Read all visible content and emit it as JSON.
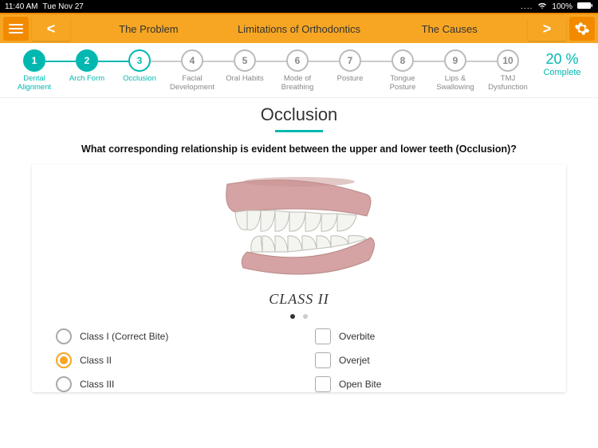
{
  "status": {
    "time": "11:40 AM",
    "date": "Tue Nov 27",
    "wifi": "100%"
  },
  "nav": {
    "prev": "<",
    "next": ">",
    "tabs": [
      "The Problem",
      "Limitations of Orthodontics",
      "The Causes"
    ]
  },
  "stepper": {
    "steps": [
      {
        "n": "1",
        "label": "Dental Alignment",
        "state": "done"
      },
      {
        "n": "2",
        "label": "Arch Form",
        "state": "done"
      },
      {
        "n": "3",
        "label": "Occlusion",
        "state": "active"
      },
      {
        "n": "4",
        "label": "Facial Development",
        "state": ""
      },
      {
        "n": "5",
        "label": "Oral Habits",
        "state": ""
      },
      {
        "n": "6",
        "label": "Mode of Breathing",
        "state": ""
      },
      {
        "n": "7",
        "label": "Posture",
        "state": ""
      },
      {
        "n": "8",
        "label": "Tongue Posture",
        "state": ""
      },
      {
        "n": "9",
        "label": "Lips & Swallowing",
        "state": ""
      },
      {
        "n": "10",
        "label": "TMJ Dysfunction",
        "state": ""
      }
    ],
    "completion_pct": "20 %",
    "completion_label": "Complete"
  },
  "section": {
    "title": "Occlusion",
    "question": "What corresponding relationship is evident between the upper and lower teeth (Occlusion)?",
    "illustration_caption": "CLASS II",
    "page_dots": {
      "count": 2,
      "active": 0
    },
    "radios": [
      {
        "label": "Class I (Correct Bite)",
        "selected": false
      },
      {
        "label": "Class II",
        "selected": true
      },
      {
        "label": "Class III",
        "selected": false
      }
    ],
    "checks": [
      {
        "label": "Overbite",
        "checked": false
      },
      {
        "label": "Overjet",
        "checked": false
      },
      {
        "label": "Open Bite",
        "checked": false
      }
    ]
  }
}
